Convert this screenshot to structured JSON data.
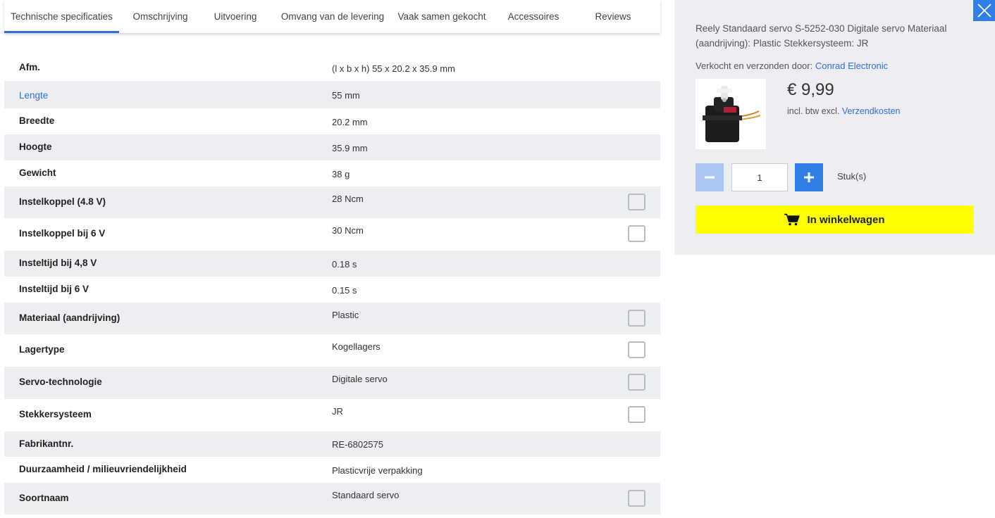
{
  "tabs": [
    {
      "label": "Technische specificaties",
      "active": true
    },
    {
      "label": "Omschrijving",
      "active": false
    },
    {
      "label": "Uitvoering",
      "active": false
    },
    {
      "label": "Omvang van de levering",
      "active": false
    },
    {
      "label": "Vaak samen gekocht",
      "active": false
    },
    {
      "label": "Accessoires",
      "active": false
    },
    {
      "label": "Reviews",
      "active": false
    }
  ],
  "specs": [
    {
      "label": "Afm.",
      "value": "(l x b x h) 55 x 20.2 x 35.9 mm",
      "link": false,
      "compare": false
    },
    {
      "label": "Lengte",
      "value": "55 mm",
      "link": true,
      "compare": false
    },
    {
      "label": "Breedte",
      "value": "20.2 mm",
      "link": false,
      "compare": false
    },
    {
      "label": "Hoogte",
      "value": "35.9 mm",
      "link": false,
      "compare": false
    },
    {
      "label": "Gewicht",
      "value": "38 g",
      "link": false,
      "compare": false
    },
    {
      "label": "Instelkoppel (4.8 V)",
      "value": "28 Ncm",
      "link": false,
      "compare": true
    },
    {
      "label": "Instelkoppel bij 6 V",
      "value": "30 Ncm",
      "link": false,
      "compare": true
    },
    {
      "label": "Insteltijd bij 4,8 V",
      "value": "0.18 s",
      "link": false,
      "compare": false
    },
    {
      "label": "Insteltijd bij 6 V",
      "value": "0.15 s",
      "link": false,
      "compare": false
    },
    {
      "label": "Materiaal (aandrijving)",
      "value": "Plastic",
      "link": false,
      "compare": true
    },
    {
      "label": "Lagertype",
      "value": "Kogellagers",
      "link": false,
      "compare": true
    },
    {
      "label": "Servo-technologie",
      "value": "Digitale servo",
      "link": false,
      "compare": true
    },
    {
      "label": "Stekkersysteem",
      "value": "JR",
      "link": false,
      "compare": true
    },
    {
      "label": "Fabrikantnr.",
      "value": "RE-6802575",
      "link": false,
      "compare": false
    },
    {
      "label": "Duurzaamheid / milieuvriendelijkheid",
      "value": "Plasticvrije verpakking",
      "link": false,
      "compare": false
    },
    {
      "label": "Soortnaam",
      "value": "Standaard servo",
      "link": false,
      "compare": true
    }
  ],
  "panel": {
    "description": "Reely Standaard servo S-5252-030 Digitale servo Materiaal (aandrijving): Plastic Stekkersysteem: JR",
    "seller_prefix": "Verkocht en verzonden door: ",
    "seller_name": "Conrad Electronic",
    "price": "€ 9,99",
    "tax_prefix": "incl. btw excl. ",
    "shipping_link": "Verzendkosten",
    "quantity": "1",
    "unit": "Stuk(s)",
    "cart_label": "In winkelwagen"
  },
  "colors": {
    "accent": "#2f7fe6",
    "link": "#2f6fde",
    "cart_button": "#ffff00",
    "row_alt": "#eceef1"
  },
  "icons": {
    "close": "close-icon",
    "minus": "minus-icon",
    "plus": "plus-icon",
    "cart": "cart-icon",
    "compare": "checkbox"
  }
}
